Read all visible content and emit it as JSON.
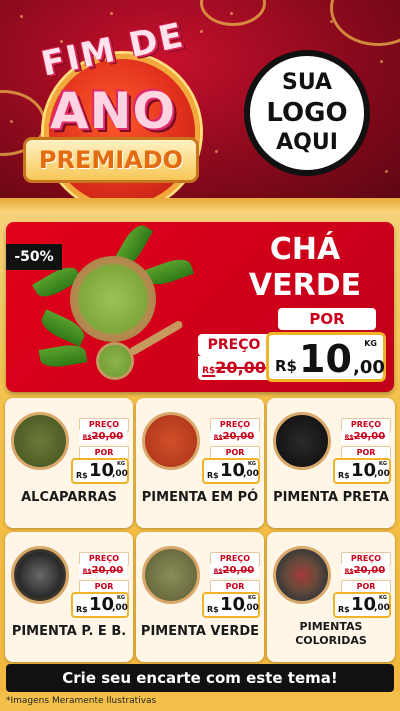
{
  "header": {
    "title_line1": "FIM DE",
    "title_line2": "ANO",
    "title_line3": "PREMIADO",
    "logo_line1": "SUA",
    "logo_line2": "LOGO",
    "logo_line3": "AQUI"
  },
  "hero": {
    "discount": "-50%",
    "name_line1": "CHÁ",
    "name_line2": "VERDE",
    "preco_label": "PREÇO",
    "old_currency": "R$",
    "old_price": "20,00",
    "por_label": "POR",
    "new_currency": "R$",
    "new_int": "10",
    "new_dec": ",00",
    "unit": "KG"
  },
  "products": [
    {
      "name": "ALCAPARRAS",
      "preco_label": "PREÇO",
      "old_currency": "R$",
      "old_price": "20,00",
      "por_label": "POR",
      "new_currency": "R$",
      "new_int": "10",
      "new_dec": ",00",
      "unit": "KG"
    },
    {
      "name": "PIMENTA EM PÓ",
      "preco_label": "PREÇO",
      "old_currency": "R$",
      "old_price": "20,00",
      "por_label": "POR",
      "new_currency": "R$",
      "new_int": "10",
      "new_dec": ",00",
      "unit": "KG"
    },
    {
      "name": "PIMENTA PRETA",
      "preco_label": "PREÇO",
      "old_currency": "R$",
      "old_price": "20,00",
      "por_label": "POR",
      "new_currency": "R$",
      "new_int": "10",
      "new_dec": ",00",
      "unit": "KG"
    },
    {
      "name": "PIMENTA P. E B.",
      "preco_label": "PREÇO",
      "old_currency": "R$",
      "old_price": "20,00",
      "por_label": "POR",
      "new_currency": "R$",
      "new_int": "10",
      "new_dec": ",00",
      "unit": "KG"
    },
    {
      "name": "PIMENTA VERDE",
      "preco_label": "PREÇO",
      "old_currency": "R$",
      "old_price": "20,00",
      "por_label": "POR",
      "new_currency": "R$",
      "new_int": "10",
      "new_dec": ",00",
      "unit": "KG"
    },
    {
      "name_line1": "PIMENTAS",
      "name_line2": "COLORIDAS",
      "preco_label": "PREÇO",
      "old_currency": "R$",
      "old_price": "20,00",
      "por_label": "POR",
      "new_currency": "R$",
      "new_int": "10",
      "new_dec": ",00",
      "unit": "KG"
    }
  ],
  "footer": {
    "cta": "Crie seu encarte com este tema!",
    "disclaimer": "*Imagens Meramente Ilustrativas"
  },
  "colors": {
    "brand_red": "#e2001a",
    "gold": "#f0b429",
    "dark_bg": "#8a0a1c"
  }
}
